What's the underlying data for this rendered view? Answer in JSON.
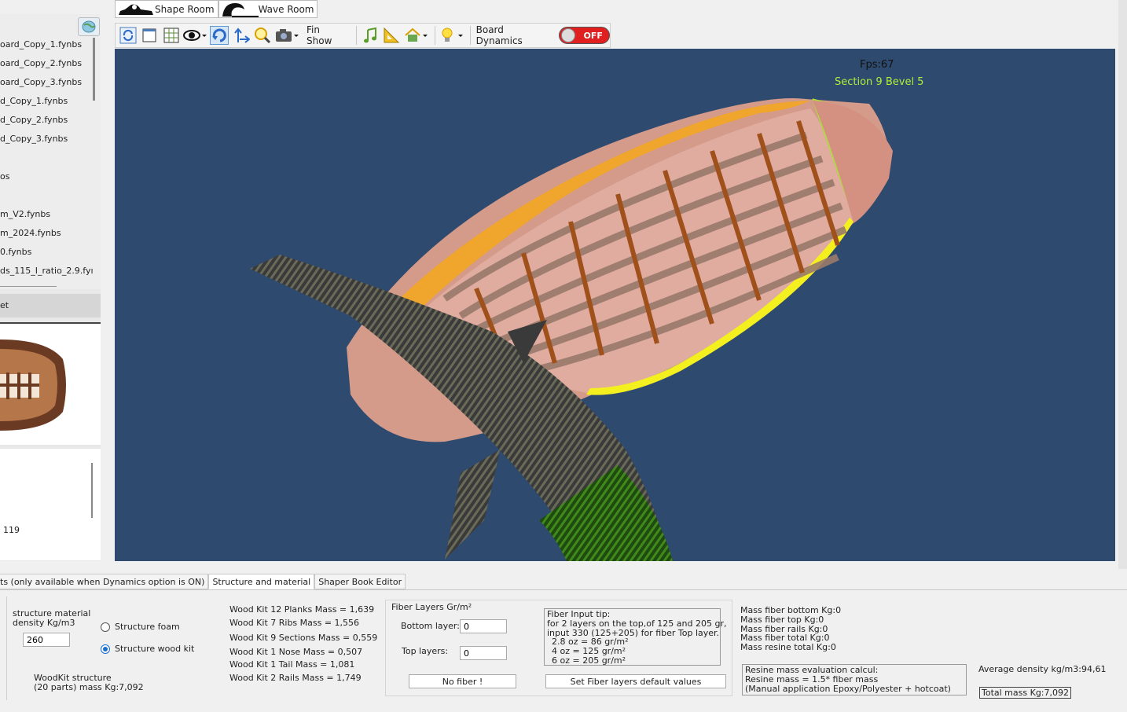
{
  "files": [
    "oard_Copy_1.fynbs",
    "oard_Copy_2.fynbs",
    "oard_Copy_3.fynbs",
    "d_Copy_1.fynbs",
    "d_Copy_2.fynbs",
    "d_Copy_3.fynbs",
    "os",
    "m_V2.fynbs",
    "m_2024.fynbs",
    "0.fynbs",
    "ds_115_I_ratio_2.9.fyı"
  ],
  "left_section_label": "et",
  "left_info_value": "119",
  "rooms": {
    "shape": "Shape Room",
    "wave": "Wave Room"
  },
  "toolbar": {
    "fin_show": "Fin Show",
    "board_dynamics": "Board Dynamics",
    "toggle_state": "OFF"
  },
  "viewport": {
    "fps": "Fps:67",
    "section_bevel": "Section 9 Bevel 5"
  },
  "bottom_tabs": [
    "ts (only available when Dynamics option is ON)",
    "Structure and material",
    "Shaper Book Editor"
  ],
  "structure": {
    "density_label_1": "structure material",
    "density_label_2": "density Kg/m3",
    "density_value": "260",
    "radio_foam": "Structure foam",
    "radio_wood": "Structure wood kit",
    "woodkit_1": "WoodKit structure",
    "woodkit_2": "(20 parts) mass Kg:7,092"
  },
  "wood_kit": [
    "Wood Kit 12 Planks Mass = 1,639",
    "Wood Kit 7 Ribs Mass = 1,556",
    "Wood Kit 9 Sections Mass = 0,559",
    "Wood Kit 1 Nose Mass = 0,507",
    "Wood Kit 1 Tail Mass = 1,081",
    "Wood Kit 2 Rails Mass = 1,749"
  ],
  "fiber": {
    "title": "Fiber Layers Gr/m²",
    "bottom_label": "Bottom layer:",
    "bottom_value": "0",
    "top_label": "Top layers:",
    "top_value": "0",
    "no_fiber_btn": "No fiber !",
    "tip_lines": [
      "Fiber Input tip:",
      "for 2 layers on the top,of 125 and 205 gr,",
      "input 330 (125+205) for fiber Top layer.",
      "  2.8 oz = 86 gr/m²",
      "  4 oz = 125 gr/m²",
      "  6 oz = 205 gr/m²"
    ],
    "default_btn": "Set Fiber layers default values"
  },
  "mass": [
    "Mass fiber bottom Kg:0",
    "Mass fiber top Kg:0",
    "Mass fiber rails Kg:0",
    "Mass fiber total Kg:0",
    "Mass resine total Kg:0"
  ],
  "resine": [
    "Resine mass evaluation calcul:",
    "Resine mass = 1.5* fiber mass",
    "(Manual application Epoxy/Polyester + hotcoat)"
  ],
  "average_density": "Average density kg/m3:94,61",
  "total_mass": "Total mass Kg:7,092",
  "colors": {
    "viewport_bg": "#2e4a6e",
    "toggle_off": "#e02020",
    "section_label": "#aef03a"
  }
}
